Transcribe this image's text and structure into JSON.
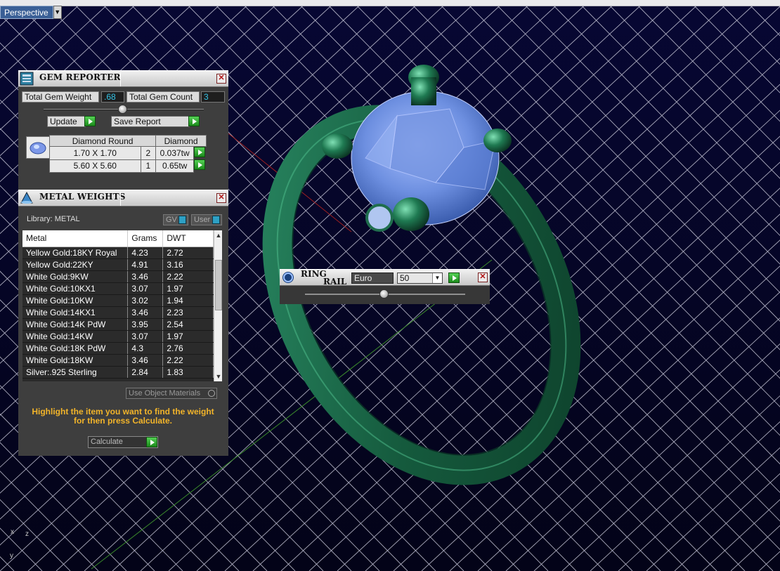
{
  "viewport": {
    "view_name": "Perspective",
    "axis_x": "x",
    "axis_z": "z",
    "axis_y": "y",
    "colors": {
      "background": "#05052e",
      "grid": "#c8c8d8",
      "ring": "#1f6e4d",
      "gem": "#6d8fe0"
    }
  },
  "gem_reporter": {
    "title": "GEM REPORTER",
    "total_weight_label": "Total Gem Weight",
    "total_weight_value": ".68",
    "total_count_label": "Total Gem Count",
    "total_count_value": "3",
    "update_label": "Update",
    "save_label": "Save Report",
    "table": {
      "headers": [
        "Diamond Round",
        "Diamond"
      ],
      "rows": [
        {
          "size": "1.70 X 1.70",
          "count": "2",
          "weight": "0.037tw"
        },
        {
          "size": "5.60 X 5.60",
          "count": "1",
          "weight": "0.65tw"
        }
      ]
    }
  },
  "metal_weights": {
    "title": "METAL WEIGHTS",
    "library_label": "Library: METAL",
    "toggle_gv": "GV",
    "toggle_user": "User",
    "columns": [
      "Metal",
      "Grams",
      "DWT"
    ],
    "rows": [
      {
        "metal": "Yellow Gold:18KY Royal",
        "grams": "4.23",
        "dwt": "2.72"
      },
      {
        "metal": "Yellow Gold:22KY",
        "grams": "4.91",
        "dwt": "3.16"
      },
      {
        "metal": "White Gold:9KW",
        "grams": "3.46",
        "dwt": "2.22"
      },
      {
        "metal": "White Gold:10KX1",
        "grams": "3.07",
        "dwt": "1.97"
      },
      {
        "metal": "White Gold:10KW",
        "grams": "3.02",
        "dwt": "1.94"
      },
      {
        "metal": "White Gold:14KX1",
        "grams": "3.46",
        "dwt": "2.23"
      },
      {
        "metal": "White Gold:14K PdW",
        "grams": "3.95",
        "dwt": "2.54"
      },
      {
        "metal": "White Gold:14KW",
        "grams": "3.07",
        "dwt": "1.97"
      },
      {
        "metal": "White Gold:18K PdW",
        "grams": "4.3",
        "dwt": "2.76"
      },
      {
        "metal": "White Gold:18KW",
        "grams": "3.46",
        "dwt": "2.22"
      },
      {
        "metal": "Silver:.925 Sterling",
        "grams": "2.84",
        "dwt": "1.83"
      }
    ],
    "use_object_materials": "Use Object Materials",
    "hint": "Highlight the item you want to find the weight for then press Calculate.",
    "calculate_label": "Calculate"
  },
  "ring_rail": {
    "title_line1": "RING",
    "title_line2": "RAIL",
    "unit": "Euro",
    "size": "50"
  }
}
